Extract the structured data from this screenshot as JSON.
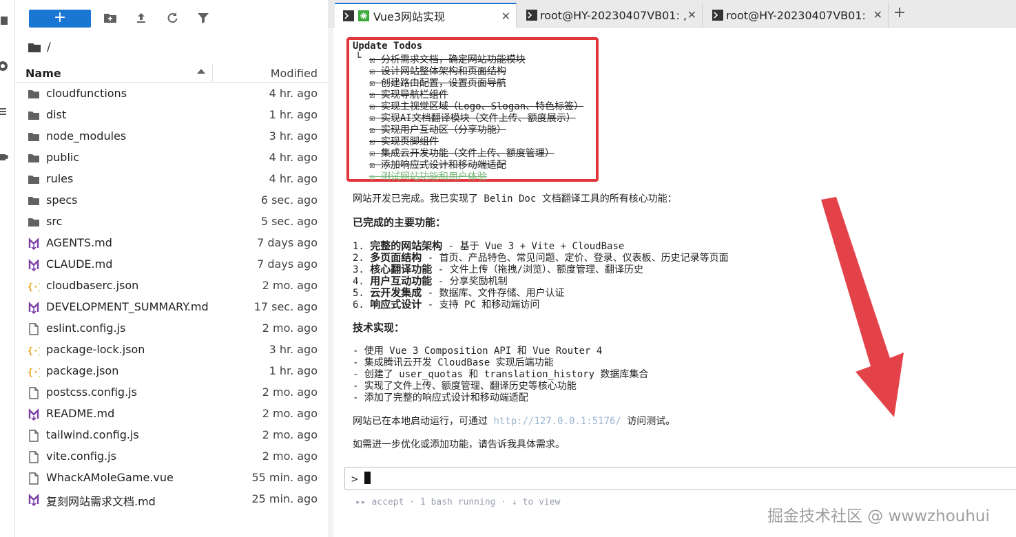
{
  "filebrowser": {
    "path": "/",
    "columns": {
      "name": "Name",
      "modified": "Modified"
    },
    "files": [
      {
        "name": "cloudfunctions",
        "modified": "4 hr. ago",
        "icon": "folder-icon"
      },
      {
        "name": "dist",
        "modified": "1 hr. ago",
        "icon": "folder-icon"
      },
      {
        "name": "node_modules",
        "modified": "3 hr. ago",
        "icon": "folder-icon"
      },
      {
        "name": "public",
        "modified": "4 hr. ago",
        "icon": "folder-icon"
      },
      {
        "name": "rules",
        "modified": "4 hr. ago",
        "icon": "folder-icon"
      },
      {
        "name": "specs",
        "modified": "6 sec. ago",
        "icon": "folder-icon"
      },
      {
        "name": "src",
        "modified": "5 sec. ago",
        "icon": "folder-icon"
      },
      {
        "name": "AGENTS.md",
        "modified": "7 days ago",
        "icon": "markdown-icon"
      },
      {
        "name": "CLAUDE.md",
        "modified": "7 days ago",
        "icon": "markdown-icon"
      },
      {
        "name": "cloudbaserc.json",
        "modified": "2 mo. ago",
        "icon": "json-icon"
      },
      {
        "name": "DEVELOPMENT_SUMMARY.md",
        "modified": "17 sec. ago",
        "icon": "markdown-icon"
      },
      {
        "name": "eslint.config.js",
        "modified": "2 mo. ago",
        "icon": "file-icon"
      },
      {
        "name": "package-lock.json",
        "modified": "3 hr. ago",
        "icon": "json-icon"
      },
      {
        "name": "package.json",
        "modified": "1 hr. ago",
        "icon": "json-icon"
      },
      {
        "name": "postcss.config.js",
        "modified": "2 mo. ago",
        "icon": "file-icon"
      },
      {
        "name": "README.md",
        "modified": "2 mo. ago",
        "icon": "markdown-icon"
      },
      {
        "name": "tailwind.config.js",
        "modified": "2 mo. ago",
        "icon": "file-icon"
      },
      {
        "name": "vite.config.js",
        "modified": "2 mo. ago",
        "icon": "file-icon"
      },
      {
        "name": "WhackAMoleGame.vue",
        "modified": "55 min. ago",
        "icon": "file-icon"
      },
      {
        "name": "复刻网站需求文档.md",
        "modified": "25 min. ago",
        "icon": "markdown-icon"
      }
    ]
  },
  "tabs": [
    {
      "label": "Vue3网站实现",
      "active": true
    },
    {
      "label": "root@HY-20230407VB01: ,",
      "active": false
    },
    {
      "label": "root@HY-20230407VB01:",
      "active": false
    }
  ],
  "terminal": {
    "todo_title": "Update Todos",
    "todo_prefix": "└",
    "todos": [
      "☒ 分析需求文档，确定网站功能模块",
      "☒ 设计网站整体架构和页面结构",
      "☒ 创建路由配置，设置页面导航",
      "☒ 实现导航栏组件",
      "☒ 实现主视觉区域（Logo、Slogan、特色标签）",
      "☒ 实现AI文档翻译模块（文件上传、额度展示）",
      "☒ 实现用户互动区（分享功能）",
      "☒ 实现页脚组件",
      "☒ 集成云开发功能（文件上传、额度管理）",
      "☒ 添加响应式设计和移动端适配"
    ],
    "todo_active": "☒ 测试网站功能和用户体验",
    "summary": "网站开发已完成。我已实现了 Belin Doc 文档翻译工具的所有核心功能：",
    "features_title": "已完成的主要功能：",
    "features": [
      {
        "num": "1.",
        "title": "完整的网站架构",
        "desc": " - 基于 Vue 3 + Vite + CloudBase"
      },
      {
        "num": "2.",
        "title": "多页面结构",
        "desc": " - 首页、产品特色、常见问题、定价、登录、仪表板、历史记录等页面"
      },
      {
        "num": "3.",
        "title": "核心翻译功能",
        "desc": " - 文件上传（拖拽/浏览）、额度管理、翻译历史"
      },
      {
        "num": "4.",
        "title": "用户互动功能",
        "desc": " - 分享奖励机制"
      },
      {
        "num": "5.",
        "title": "云开发集成",
        "desc": " - 数据库、文件存储、用户认证"
      },
      {
        "num": "6.",
        "title": "响应式设计",
        "desc": " - 支持 PC 和移动端访问"
      }
    ],
    "tech_title": "技术实现：",
    "tech": [
      "- 使用 Vue 3 Composition API 和 Vue Router 4",
      "- 集成腾讯云开发 CloudBase 实现后端功能",
      "- 创建了 user_quotas 和 translation_history 数据库集合",
      "- 实现了文件上传、额度管理、翻译历史等核心功能",
      "- 添加了完整的响应式设计和移动端适配"
    ],
    "run_prefix": "网站已在本地启动运行，可通过 ",
    "run_url": "http://127.0.0.1:5176/",
    "run_suffix": " 访问测试。",
    "closing": "如需进一步优化或添加功能，请告诉我具体需求。",
    "prompt_symbol": ">",
    "status": "▸▸ accept  · 1 bash running  · ↓ to view"
  },
  "watermark": "掘金技术社区 @ wwwzhouhui",
  "colors": {
    "accent": "#1976d2",
    "highlight_box": "#e2343b",
    "markdown": "#7b3fa6",
    "json": "#e8a317"
  }
}
